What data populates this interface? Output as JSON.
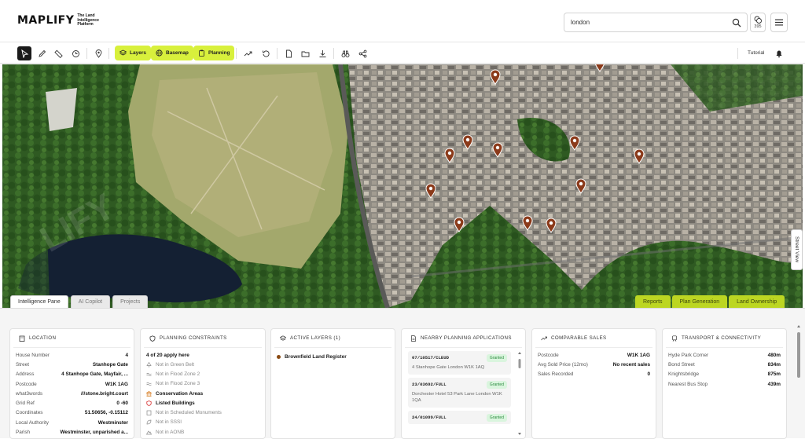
{
  "header": {
    "logo": "MAPLIFY",
    "logo_tagline": "The Land Intelligence Platform",
    "search_value": "london",
    "credits_count": "395"
  },
  "toolbar": {
    "layers_label": "Layers",
    "basemap_label": "Basemap",
    "planning_label": "Planning",
    "tutorial_label": "Tutorial"
  },
  "map": {
    "street_view_label": "Street View",
    "tabs": [
      "Intelligence Pane",
      "AI Copilot",
      "Projects"
    ],
    "actions": [
      "Reports",
      "Plan Generation",
      "Land Ownership"
    ]
  },
  "location": {
    "title": "LOCATION",
    "rows": [
      {
        "k": "House Number",
        "v": "4"
      },
      {
        "k": "Street",
        "v": "Stanhope Gate"
      },
      {
        "k": "Address",
        "v": "4 Stanhope Gate, Mayfair, ..."
      },
      {
        "k": "Postcode",
        "v": "W1K 1AG"
      },
      {
        "k": "what3words",
        "v": "///stone.bright.court"
      },
      {
        "k": "Grid Ref",
        "v": "0 -60"
      },
      {
        "k": "Coordinates",
        "v": "51.50656, -0.15112"
      },
      {
        "k": "Local Authority",
        "v": "Westminster"
      },
      {
        "k": "Parish",
        "v": "Westminster, unparished a..."
      }
    ]
  },
  "planning_constraints": {
    "title": "PLANNING CONSTRAINTS",
    "summary": "4 of 20 apply here",
    "items": [
      {
        "label": "Not in Green Belt",
        "hit": false
      },
      {
        "label": "Not in Flood Zone 2",
        "hit": false
      },
      {
        "label": "Not in Flood Zone 3",
        "hit": false
      },
      {
        "label": "Conservation Areas",
        "hit": true
      },
      {
        "label": "Listed Buildings",
        "hit": true
      },
      {
        "label": "Not in Scheduled Monuments",
        "hit": false
      },
      {
        "label": "Not in SSSI",
        "hit": false
      },
      {
        "label": "Not in AONB",
        "hit": false
      }
    ]
  },
  "active_layers": {
    "title": "ACTIVE LAYERS (1)",
    "items": [
      "Brownfield Land Register"
    ]
  },
  "nearby_applications": {
    "title": "NEARBY PLANNING APPLICATIONS",
    "items": [
      {
        "ref": "07/10517/CLEUD",
        "address": "4 Stanhope Gate London W1K 1AQ",
        "status": "Granted"
      },
      {
        "ref": "23/03692/FULL",
        "address": "Dorchester Hotel 53 Park Lane London W1K 1QA",
        "status": "Granted"
      },
      {
        "ref": "24/01099/FULL",
        "address": "",
        "status": "Granted"
      }
    ]
  },
  "comparable_sales": {
    "title": "COMPARABLE SALES",
    "rows": [
      {
        "k": "Postcode",
        "v": "W1K 1AG"
      },
      {
        "k": "Avg Sold Price (12mo)",
        "v": "No recent sales"
      },
      {
        "k": "Sales Recorded",
        "v": "0"
      }
    ]
  },
  "transport": {
    "title": "TRANSPORT & CONNECTIVITY",
    "rows": [
      {
        "k": "Hyde Park Corner",
        "v": "480m"
      },
      {
        "k": "Bond Street",
        "v": "834m"
      },
      {
        "k": "Knightsbridge",
        "v": "875m"
      },
      {
        "k": "Nearest Bus Stop",
        "v": "439m"
      }
    ]
  },
  "colors": {
    "accent": "#d8f03c",
    "pin": "#8b3a1a",
    "granted": "#2b8a3e"
  }
}
